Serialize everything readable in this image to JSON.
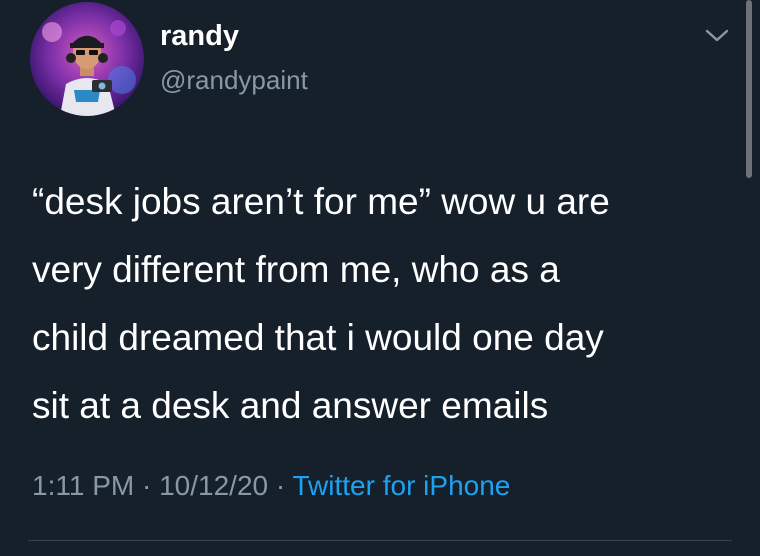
{
  "user": {
    "display_name": "randy",
    "handle": "@randypaint"
  },
  "tweet": {
    "lines": [
      "“desk jobs aren’t for me” wow u are",
      "very different from me, who as a",
      "child dreamed that i would one day",
      "sit at a desk and answer emails"
    ]
  },
  "meta": {
    "time": "1:11 PM",
    "separator": "·",
    "date": "10/12/20",
    "source": "Twitter for iPhone"
  },
  "icons": {
    "menu": "chevron-down-icon",
    "avatar": "avatar-photo"
  },
  "colors": {
    "background": "#15202b",
    "primary_text": "#ffffff",
    "secondary_text": "#8899a6",
    "link": "#1da1f2"
  }
}
